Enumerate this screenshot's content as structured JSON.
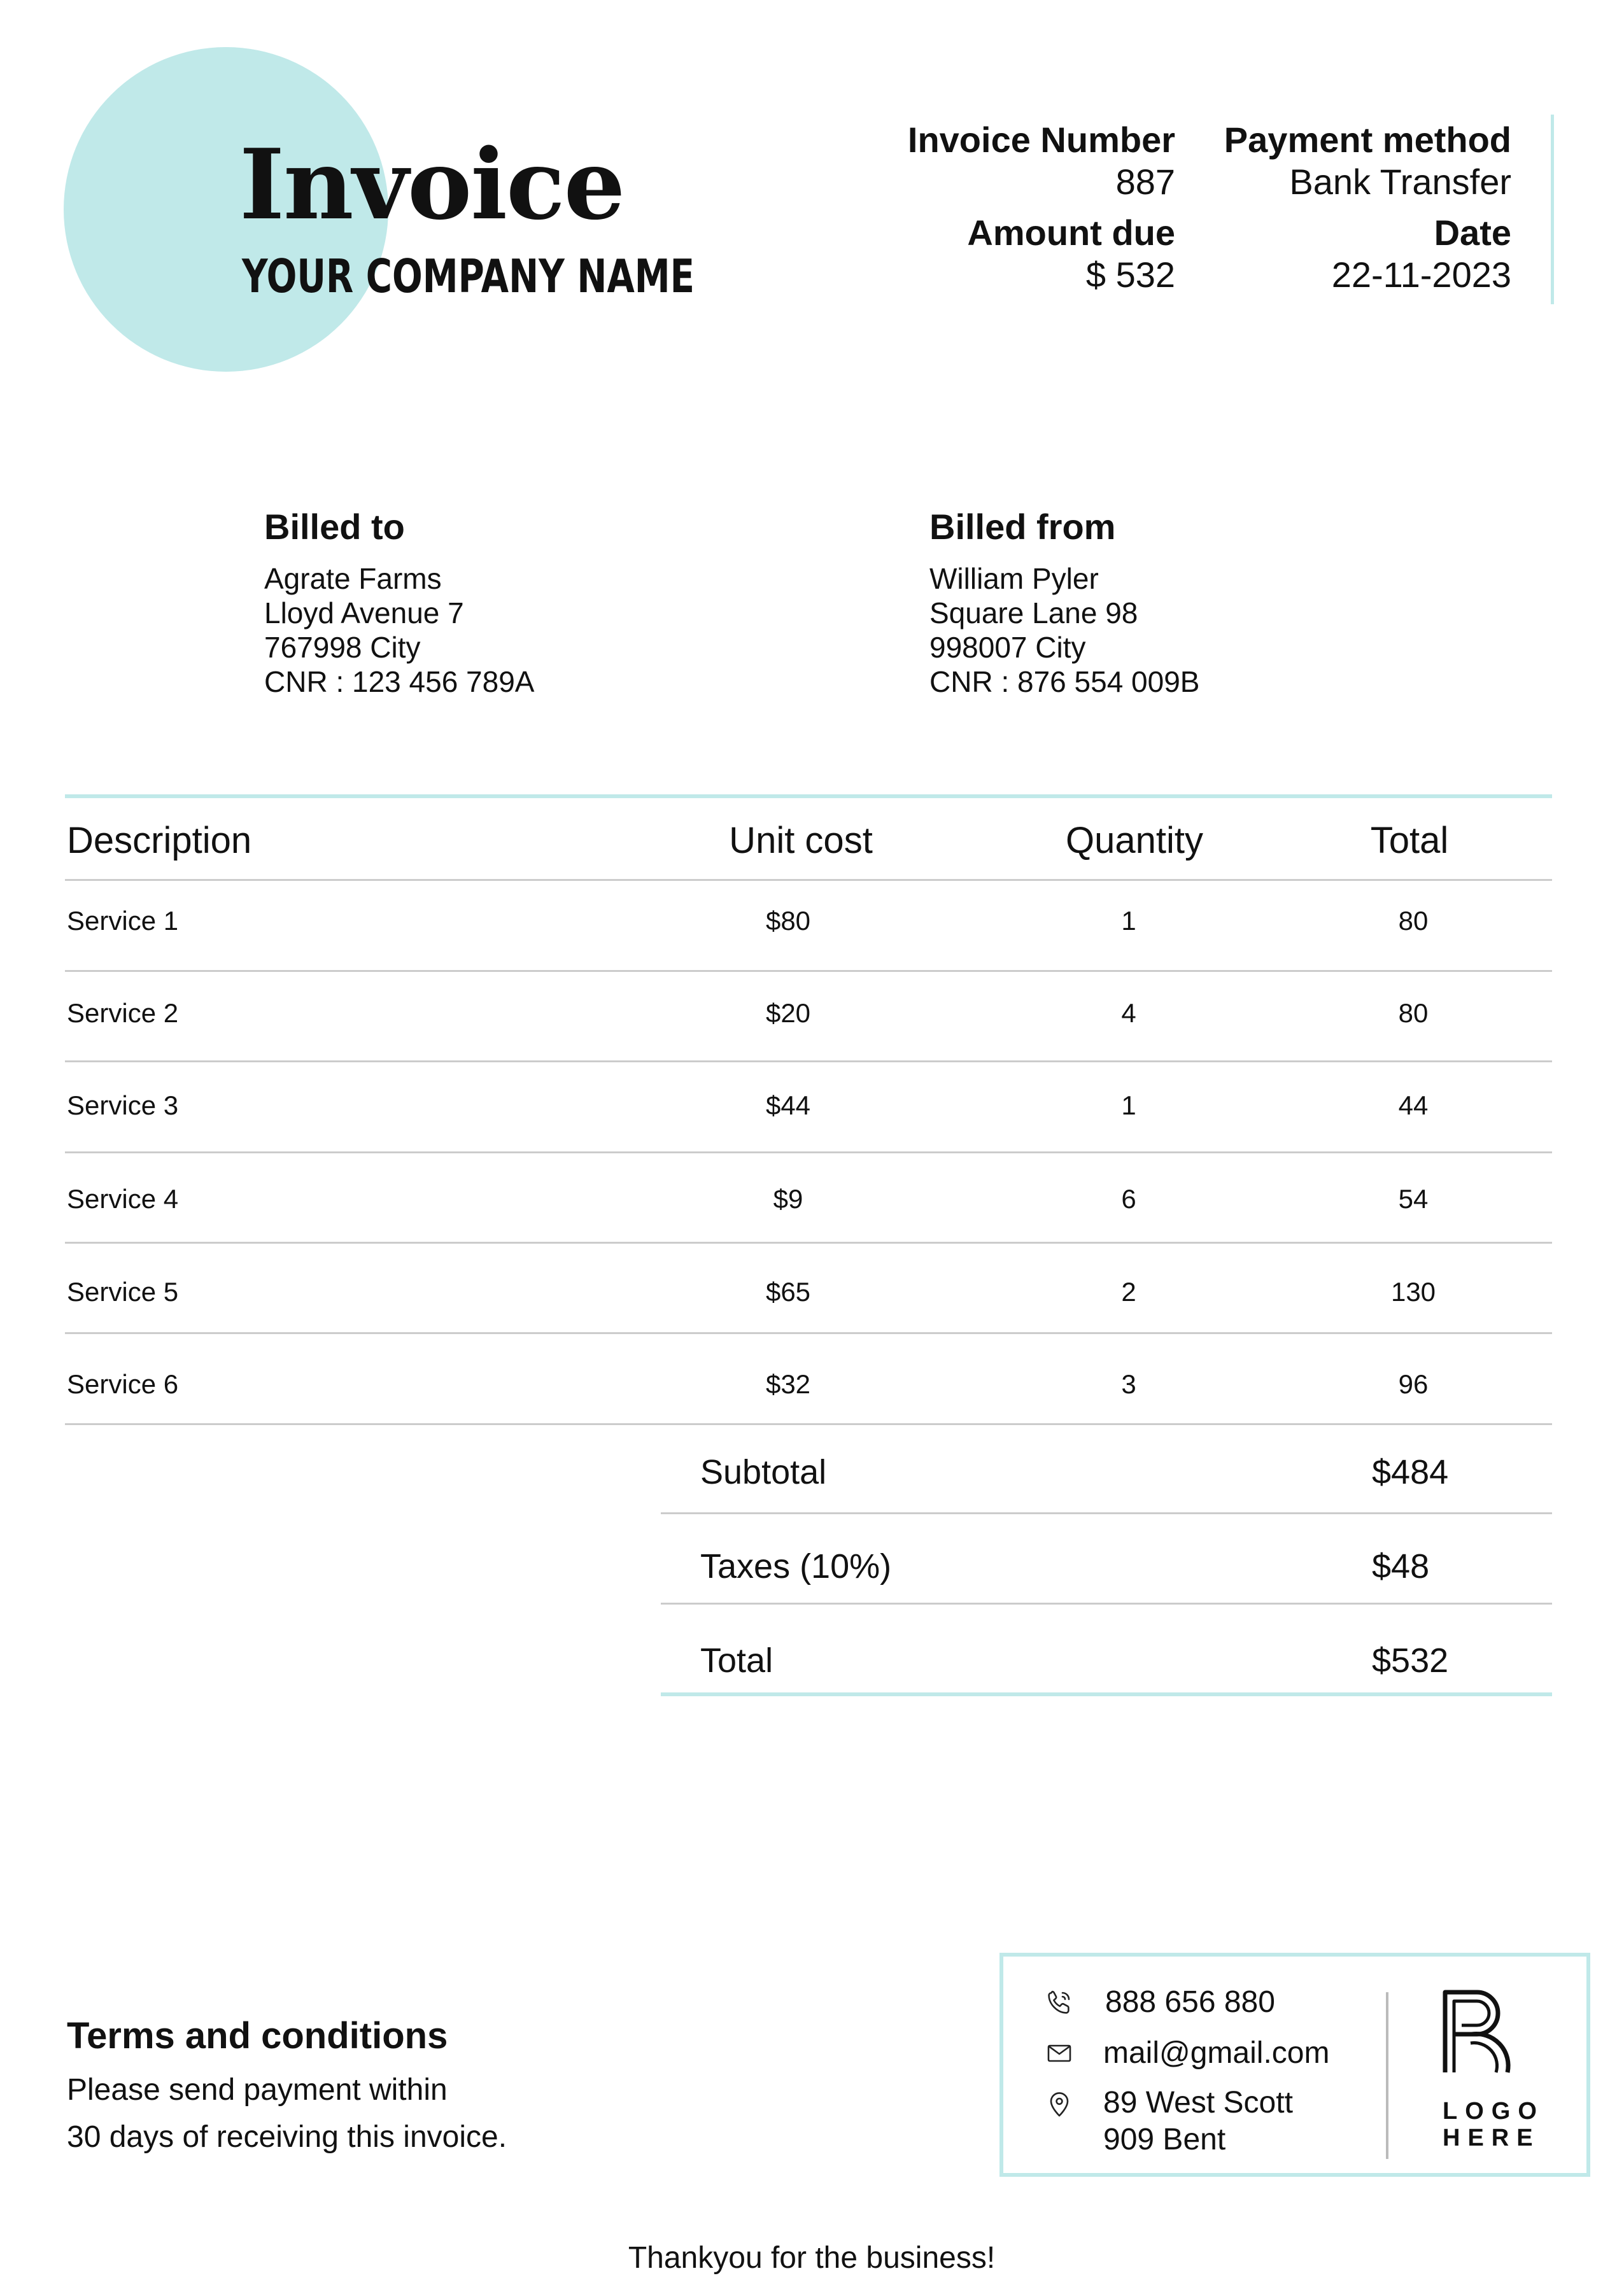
{
  "header": {
    "title": "Invoice",
    "company": "YOUR COMPANY NAME",
    "invoice_number_label": "Invoice Number",
    "invoice_number": "887",
    "payment_method_label": "Payment method",
    "payment_method": "Bank Transfer",
    "amount_due_label": "Amount due",
    "amount_due": "$ 532",
    "date_label": "Date",
    "date": "22-11-2023"
  },
  "billed_to": {
    "title": "Billed to",
    "lines": [
      "Agrate Farms",
      "Lloyd Avenue 7",
      "767998 City",
      "CNR : 123 456 789A"
    ]
  },
  "billed_from": {
    "title": "Billed from",
    "lines": [
      "William Pyler",
      "Square Lane 98",
      "998007 City",
      "CNR : 876 554 009B"
    ]
  },
  "table": {
    "headers": [
      "Description",
      "Unit cost",
      "Quantity",
      "Total"
    ],
    "rows": [
      [
        "Service 1",
        "$80",
        "1",
        "80"
      ],
      [
        "Service 2",
        "$20",
        "4",
        "80"
      ],
      [
        "Service 3",
        "$44",
        "1",
        "44"
      ],
      [
        "Service 4",
        "$9",
        "6",
        "54"
      ],
      [
        "Service 5",
        "$65",
        "2",
        "130"
      ],
      [
        "Service 6",
        "$32",
        "3",
        "96"
      ]
    ]
  },
  "summary": {
    "subtotal_label": "Subtotal",
    "subtotal": "$484",
    "taxes_label": "Taxes (10%)",
    "taxes": "$48",
    "total_label": "Total",
    "total": "$532"
  },
  "terms": {
    "title": "Terms and conditions",
    "line1": "Please send payment within",
    "line2": "30 days of receiving this invoice."
  },
  "contact": {
    "phone": "888 656 880",
    "email": "mail@gmail.com",
    "address_line1": "89 West Scott",
    "address_line2": "909 Bent",
    "phone_icon": "phone-icon",
    "email_icon": "mail-icon",
    "address_icon": "location-pin-icon"
  },
  "logo": {
    "line1": "LOGO",
    "line2": "HERE"
  },
  "footer": {
    "thanks": "Thankyou for the business!"
  },
  "colors": {
    "accent": "#c0e9e9",
    "text": "#111111",
    "rule": "#cccccc"
  }
}
